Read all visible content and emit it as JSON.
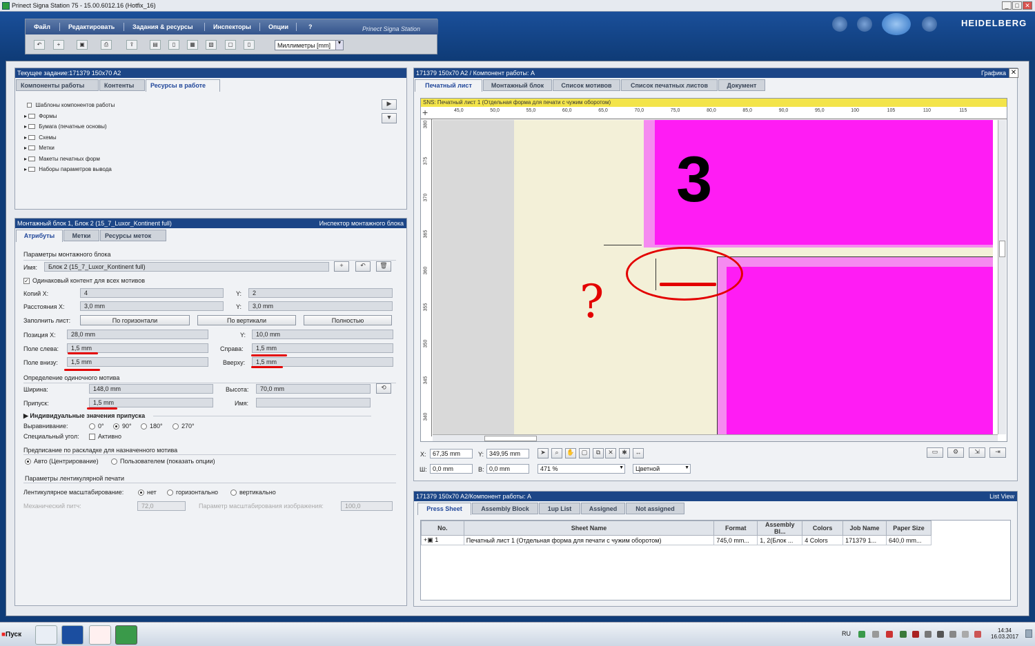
{
  "window": {
    "title": "Prinect Signa Station 75  -  15.00.6012.16 (Hotfix_16)"
  },
  "menu": {
    "items": [
      "Файл",
      "Редактировать",
      "Задания & ресурсы",
      "Инспекторы",
      "Опции",
      "?"
    ],
    "brand": "Prinect Signa Station"
  },
  "toolbar": {
    "units": "Миллиметры  [mm]",
    "logo": "HEIDELBERG"
  },
  "left_top": {
    "header": "Текущее задание:171379 150x70 A2",
    "tabs": [
      "Компоненты работы",
      "Контенты",
      "Ресурсы в работе"
    ],
    "tree": [
      "Шаблоны компонентов работы",
      "Формы",
      "Бумага (печатные основы)",
      "Схемы",
      "Метки",
      "Макеты печатных форм",
      "Наборы параметров вывода"
    ]
  },
  "inspector": {
    "header": "Монтажный блок 1, Блок 2 (15_7_Luxor_Kontinent full)",
    "header_right": "Инспектор монтажного блока",
    "tabs": [
      "Атрибуты",
      "Метки",
      "Ресурсы меток"
    ],
    "section_params": "Параметры монтажного блока",
    "name_label": "Имя:",
    "name_value": "Блок 2 (15_7_Luxor_Kontinent full)",
    "same_content": "Одинаковый контент для всех мотивов",
    "copies_x_label": "Копий X:",
    "copies_x": "4",
    "copies_y_label": "Y:",
    "copies_y": "2",
    "dist_x_label": "Расстояния X:",
    "dist_x": "3,0 mm",
    "dist_y_label": "Y:",
    "dist_y": "3,0 mm",
    "fill_label": "Заполнить лист:",
    "fill_h": "По горизонтали",
    "fill_v": "По вертикали",
    "fill_full": "Полностью",
    "pos_x_label": "Позиция X:",
    "pos_x": "28,0 mm",
    "pos_y_label": "Y:",
    "pos_y": "10,0 mm",
    "left_margin_label": "Поле слева:",
    "left_margin": "1,5 mm",
    "right_label": "Справа:",
    "right_margin": "1,5 mm",
    "bottom_label": "Поле внизу:",
    "bottom_margin": "1,5 mm",
    "top_label": "Вверху:",
    "top_margin": "1,5 mm",
    "section_single": "Определение одиночного мотива",
    "width_label": "Ширина:",
    "width": "148,0 mm",
    "height_label": "Высота:",
    "height": "70,0 mm",
    "bleed_label": "Припуск:",
    "bleed": "1,5 mm",
    "name2_label": "Имя:",
    "name2": "",
    "individual_bleed": "Индивидуальные значения припуска",
    "align_label": "Выравнивание:",
    "align_options": [
      "0°",
      "90°",
      "180°",
      "270°"
    ],
    "align_selected": "90°",
    "special_angle_label": "Специальный угол:",
    "special_angle_check": "Активно",
    "section_layout": "Предписание по раскладке для назначенного мотива",
    "layout_auto": "Авто (Центрирование)",
    "layout_user": "Пользователем (показать опции)",
    "section_lenticular": "Параметры лентикулярной печати",
    "lent_scale_label": "Лентикулярное масштабирование:",
    "lent_options": [
      "нет",
      "горизонтально",
      "вертикально"
    ],
    "mech_pitch_label": "Механический питч:",
    "mech_pitch": "72,0",
    "img_scale_label": "Параметр масштабирования изображения:",
    "img_scale": "100,0"
  },
  "graphics": {
    "header": "171379 150x70 A2 / Компонент работы: A",
    "header_right": "Графика",
    "tabs": [
      "Печатный лист",
      "Монтажный блок",
      "Список мотивов",
      "Список печатных листов",
      "Документ"
    ],
    "sns": "SNS:  Печатный лист 1 (Отдельная форма для печати с чужим оборотом)",
    "ruler_h": [
      "45,0",
      "50,0",
      "55,0",
      "60,0",
      "65,0",
      "70,0",
      "75,0",
      "80,0",
      "85,0",
      "90,0",
      "95,0",
      "100",
      "105",
      "110",
      "115"
    ],
    "ruler_v": [
      "380",
      "375",
      "370",
      "365",
      "360",
      "355",
      "350",
      "345",
      "340"
    ],
    "big_number": "3",
    "annotation": "?",
    "x_label": "X:",
    "x_value": "67,35 mm",
    "y_label": "Y:",
    "y_value": "349,95 mm",
    "w_label": "Ш:",
    "w_value": "0,0 mm",
    "h_label": "В:",
    "h_value": "0,0 mm",
    "zoom": "471 %",
    "color_mode": "Цветной"
  },
  "list": {
    "header": "171379 150x70 A2/Компонент работы: A",
    "header_right": "List View",
    "tabs": [
      "Press Sheet",
      "Assembly Block",
      "1up List",
      "Assigned",
      "Not assigned"
    ],
    "columns": [
      "No.",
      "Sheet Name",
      "Format",
      "Assembly Bl...",
      "Colors",
      "Job Name",
      "Paper Size"
    ],
    "rows": [
      [
        "1",
        "Печатный лист 1 (Отдельная форма для печати с чужим оборотом)",
        "745,0 mm...",
        "1, 2(Блок ...",
        "4 Colors",
        "171379 1...",
        "640,0 mm..."
      ]
    ]
  },
  "taskbar": {
    "start": "Пуск",
    "lang": "RU",
    "time": "14:34",
    "date": "16.03.2017"
  }
}
